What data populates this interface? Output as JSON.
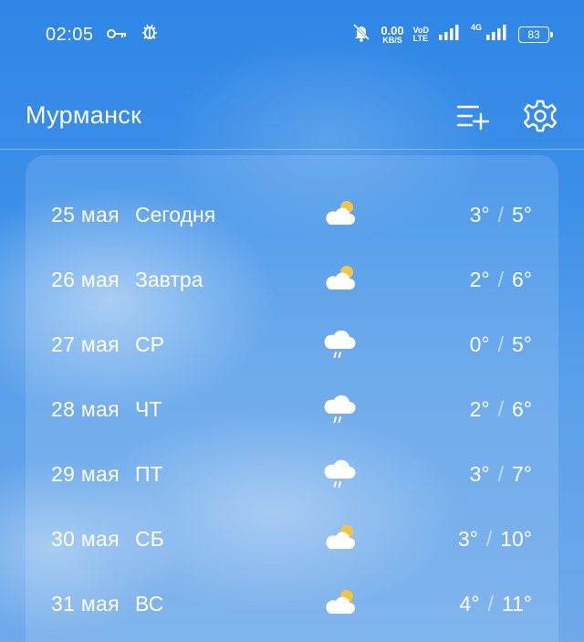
{
  "status_bar": {
    "time": "02:05",
    "speed_value": "0.00",
    "speed_unit": "KB/S",
    "volte_top": "VoD",
    "volte_bottom": "LTE",
    "net_type": "4G",
    "battery": "83",
    "icons": [
      "key-icon",
      "bug-icon",
      "bell-muted-icon",
      "signal-icon",
      "signal-icon"
    ]
  },
  "header": {
    "city": "Мурманск",
    "icons": [
      "add-list-icon",
      "settings-icon"
    ]
  },
  "forecast": [
    {
      "date": "25 мая",
      "day": "Сегодня",
      "icon": "partly-cloudy-icon",
      "low": "3°",
      "high": "5°"
    },
    {
      "date": "26 мая",
      "day": "Завтра",
      "icon": "partly-cloudy-icon",
      "low": "2°",
      "high": "6°"
    },
    {
      "date": "27 мая",
      "day": "СР",
      "icon": "rain-icon",
      "low": "0°",
      "high": "5°"
    },
    {
      "date": "28 мая",
      "day": "ЧТ",
      "icon": "rain-icon",
      "low": "2°",
      "high": "6°"
    },
    {
      "date": "29 мая",
      "day": "ПТ",
      "icon": "rain-icon",
      "low": "3°",
      "high": "7°"
    },
    {
      "date": "30 мая",
      "day": "СБ",
      "icon": "partly-cloudy-icon",
      "low": "3°",
      "high": "10°"
    },
    {
      "date": "31 мая",
      "day": "ВС",
      "icon": "partly-cloudy-icon",
      "low": "4°",
      "high": "11°"
    }
  ],
  "temp_separator": "/",
  "colors": {
    "sun": "#f4c542",
    "text": "#ffffff"
  }
}
